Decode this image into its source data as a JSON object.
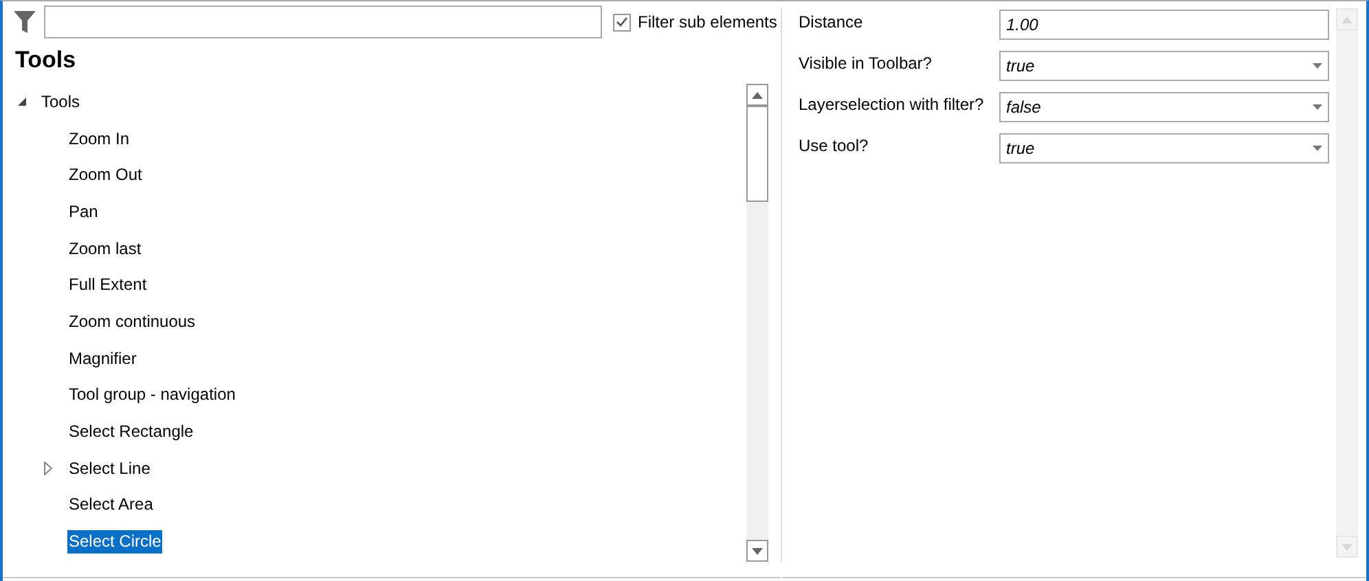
{
  "filter": {
    "checkbox": {
      "label": "Filter sub elements",
      "checked": true
    }
  },
  "heading": "Tools",
  "tree": [
    {
      "label": "Tools",
      "expanded": true,
      "selected": false,
      "children": [
        {
          "label": "Zoom In",
          "kind": "leaf",
          "selected": false
        },
        {
          "label": "Zoom Out",
          "kind": "leaf",
          "selected": false
        },
        {
          "label": "Pan",
          "kind": "leaf",
          "selected": false
        },
        {
          "label": "Zoom last",
          "kind": "leaf",
          "selected": false
        },
        {
          "label": "Full Extent",
          "kind": "leaf",
          "selected": false
        },
        {
          "label": "Zoom continuous",
          "kind": "leaf",
          "selected": false
        },
        {
          "label": "Magnifier",
          "kind": "leaf",
          "selected": false
        },
        {
          "label": "Tool group - navigation",
          "kind": "leaf",
          "selected": false
        },
        {
          "label": "Select Rectangle",
          "kind": "leaf",
          "selected": false
        },
        {
          "label": "Select Line",
          "kind": "group",
          "selected": false
        },
        {
          "label": "Select Area",
          "kind": "leaf",
          "selected": false
        },
        {
          "label": "Select Circle",
          "kind": "leaf",
          "selected": true
        }
      ]
    }
  ],
  "properties": [
    {
      "label": "Distance",
      "kind": "text",
      "value": "1.00"
    },
    {
      "label": "Visible in Toolbar?",
      "kind": "dropdown",
      "value": "true"
    },
    {
      "label": "Layerselection with filter?",
      "kind": "dropdown",
      "value": "false"
    },
    {
      "label": "Use tool?",
      "kind": "dropdown",
      "value": "true"
    }
  ]
}
